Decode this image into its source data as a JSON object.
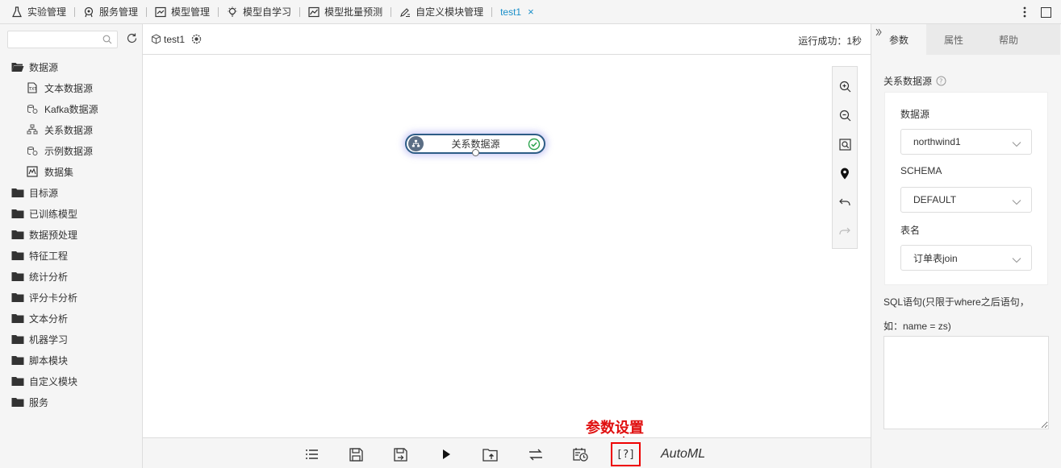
{
  "topnav": {
    "items": [
      {
        "label": "实验管理",
        "icon": "flask-icon"
      },
      {
        "label": "服务管理",
        "icon": "service-icon"
      },
      {
        "label": "模型管理",
        "icon": "chart-line-icon"
      },
      {
        "label": "模型自学习",
        "icon": "lightbulb-icon"
      },
      {
        "label": "模型批量预测",
        "icon": "chart-area-icon"
      },
      {
        "label": "自定义模块管理",
        "icon": "pen-list-icon"
      }
    ],
    "active_tab": "test1",
    "close_glyph": "×"
  },
  "sidebar": {
    "search_placeholder": "",
    "tree": [
      {
        "label": "数据源",
        "level": 0,
        "icon": "folder-open-icon"
      },
      {
        "label": "文本数据源",
        "level": 1,
        "icon": "text-file-icon"
      },
      {
        "label": "Kafka数据源",
        "level": 1,
        "icon": "kafka-icon"
      },
      {
        "label": "关系数据源",
        "level": 1,
        "icon": "relation-icon"
      },
      {
        "label": "示例数据源",
        "level": 1,
        "icon": "sample-db-icon"
      },
      {
        "label": "数据集",
        "level": 1,
        "icon": "dataset-icon"
      },
      {
        "label": "目标源",
        "level": 0,
        "icon": "folder-icon"
      },
      {
        "label": "已训练模型",
        "level": 0,
        "icon": "folder-icon"
      },
      {
        "label": "数据预处理",
        "level": 0,
        "icon": "folder-icon"
      },
      {
        "label": "特征工程",
        "level": 0,
        "icon": "folder-icon"
      },
      {
        "label": "统计分析",
        "level": 0,
        "icon": "folder-icon"
      },
      {
        "label": "评分卡分析",
        "level": 0,
        "icon": "folder-icon"
      },
      {
        "label": "文本分析",
        "level": 0,
        "icon": "folder-icon"
      },
      {
        "label": "机器学习",
        "level": 0,
        "icon": "folder-icon"
      },
      {
        "label": "脚本模块",
        "level": 0,
        "icon": "folder-icon"
      },
      {
        "label": "自定义模块",
        "level": 0,
        "icon": "folder-icon"
      },
      {
        "label": "服务",
        "level": 0,
        "icon": "folder-icon"
      }
    ]
  },
  "canvas": {
    "title": "test1",
    "status": "运行成功：1秒",
    "node": {
      "label": "关系数据源"
    }
  },
  "bottom": {
    "automl_label": "AutoML",
    "param_button_label": "[?]",
    "annotation": "参数设置"
  },
  "rpanel": {
    "tabs": [
      "参数",
      "属性",
      "帮助"
    ],
    "section_title": "关系数据源",
    "fields": [
      {
        "label": "数据源",
        "value": "northwind1"
      },
      {
        "label": "SCHEMA",
        "value": "DEFAULT"
      },
      {
        "label": "表名",
        "value": "订单表join"
      }
    ],
    "sql_label_line1": "SQL语句(只限于where之后语句，",
    "sql_label_line2": "如：name = zs)",
    "sql_value": ""
  },
  "colors": {
    "accent": "#1a8fc9",
    "node_border": "#2e5d86",
    "success": "#2ea44f",
    "annotation": "#e01010"
  }
}
